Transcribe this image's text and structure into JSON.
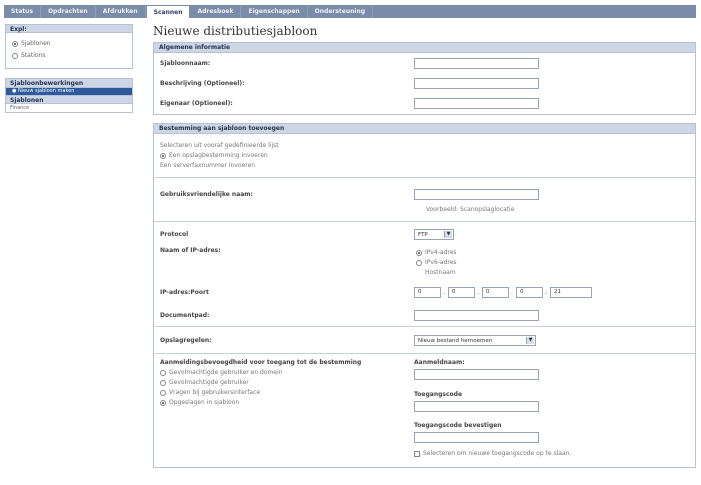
{
  "nav": {
    "tabs": [
      {
        "label": "Status"
      },
      {
        "label": "Opdrachten"
      },
      {
        "label": "Afdrukken"
      },
      {
        "label": "Scannen"
      },
      {
        "label": "Adresboek"
      },
      {
        "label": "Eigenschappen"
      },
      {
        "label": "Ondersteuning"
      }
    ],
    "active_index": 3
  },
  "sidebar": {
    "display_heading": "Expl:",
    "display_options": [
      {
        "label": "Sjablonen",
        "checked": true
      },
      {
        "label": "Stations",
        "checked": false
      }
    ],
    "tasks_heading": "Sjabloonbewerkingen",
    "task_selected": "Nieuw sjabloon maken",
    "templates_heading": "Sjablonen",
    "template_item": "Finance"
  },
  "main": {
    "title": "Nieuwe distributiesjabloon",
    "general": {
      "heading": "Algemene informatie",
      "name_label": "Sjabloonnaam:",
      "description_label": "Beschrijving (Optioneel):",
      "owner_label": "Eigenaar (Optioneel):"
    },
    "destination": {
      "heading": "Bestemming aan sjabloon toevoegen",
      "options": [
        {
          "label": "Selecteren uit vooraf gedefinieerde lijst",
          "checked": false
        },
        {
          "label": "Een opslagbestemming invoeren",
          "checked": true
        },
        {
          "label": "Een serverfaxnummer invoeren",
          "checked": false
        }
      ],
      "friendly_name_label": "Gebruiksvriendelijke naam:",
      "friendly_name_example": "Voorbeeld: Scanopslaglocatie",
      "protocol_label": "Protocol",
      "protocol_value": "FTP",
      "address_label": "Naam of IP-adres:",
      "address_options": [
        {
          "label": "IPv4-adres",
          "checked": true
        },
        {
          "label": "IPv6-adres",
          "checked": false
        },
        {
          "label": "Hostnaam",
          "checked": false
        }
      ],
      "ip_port_label": "IP-adres:Poort",
      "ip_segments": [
        "0",
        "0",
        "0",
        "0"
      ],
      "port_value": "21",
      "document_path_label": "Documentpad:",
      "filing_label": "Opslagregelen:",
      "filing_value": "Nieuw bestand hernoemen",
      "auth_label": "Aanmeldingsbevoegdheid voor toegang tot de bestemming",
      "auth_options": [
        {
          "label": "Gevolmachtigde gebruiker en domein",
          "checked": false
        },
        {
          "label": "Gevolmachtigde gebruiker",
          "checked": false
        },
        {
          "label": "Vragen bij gebruikersinterface",
          "checked": false
        },
        {
          "label": "Opgeslagen in sjabloon",
          "checked": true
        }
      ],
      "login_name_label": "Aanmeldnaam:",
      "password_label": "Toegangscode",
      "confirm_password_label": "Toegangscode bevestigen",
      "new_password_checkbox_label": "Selecteren om nieuwe toegangscode op te slaan."
    }
  }
}
